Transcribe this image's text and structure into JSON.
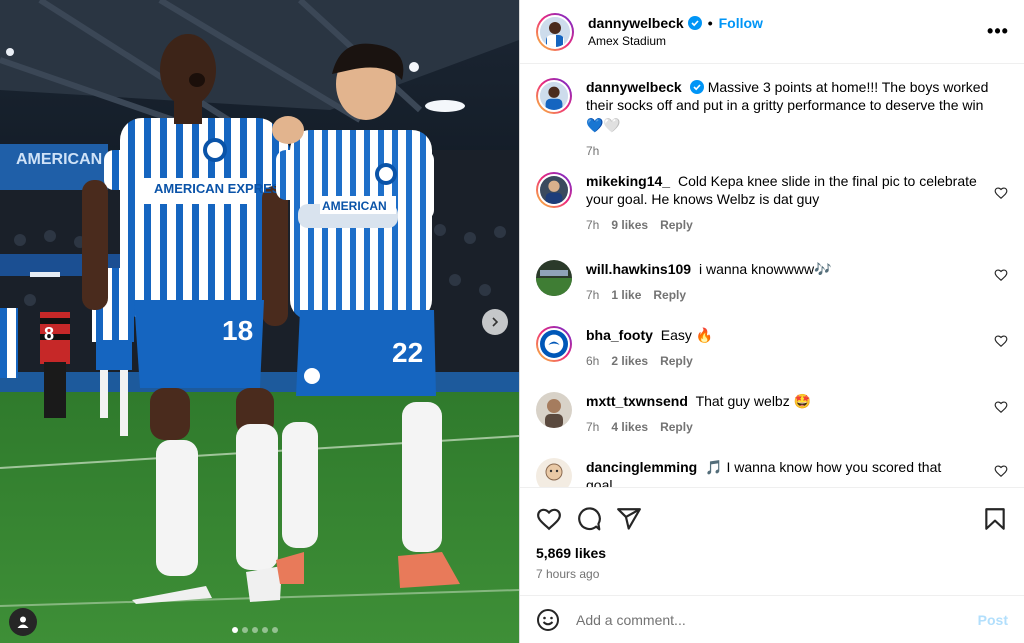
{
  "photo": {
    "ad_board_text": "AMERICAN EXPRESS",
    "shirt_sponsor": "AMERICAN EXPRESS",
    "player1_number": "18",
    "player2_number": "22",
    "opponent_number": "8",
    "carousel_total": 5,
    "carousel_active": 0,
    "next_icon": "chevron-right-icon",
    "tag_icon": "person-tag-icon"
  },
  "post_header": {
    "username": "dannywelbeck",
    "separator": "•",
    "follow_label": "Follow",
    "location": "Amex Stadium",
    "more_label": "•••"
  },
  "caption": {
    "username": "dannywelbeck",
    "text": "Massive 3 points at home!!! The boys worked their socks off and put in a gritty performance to deserve the win",
    "emojis": "💙🤍",
    "time": "7h"
  },
  "comments": [
    {
      "username": "mikeking14_",
      "text": "Cold Kepa knee slide in the final pic to celebrate your goal. He knows Welbz is dat guy",
      "time": "7h",
      "likes": "9 likes",
      "reply": "Reply"
    },
    {
      "username": "will.hawkins109",
      "text": "i wanna knowwww🎶",
      "time": "7h",
      "likes": "1 like",
      "reply": "Reply"
    },
    {
      "username": "bha_footy",
      "text": "Easy 🔥",
      "time": "6h",
      "likes": "2 likes",
      "reply": "Reply"
    },
    {
      "username": "mxtt_txwnsend",
      "text": "That guy welbz 🤩",
      "time": "7h",
      "likes": "4 likes",
      "reply": "Reply"
    },
    {
      "username": "dancinglemming",
      "text": "🎵 I wanna know how you scored that goal...",
      "time": "",
      "likes": "",
      "reply": ""
    }
  ],
  "actions": {
    "like_icon": "heart-icon",
    "comment_icon": "comment-icon",
    "share_icon": "share-icon",
    "save_icon": "bookmark-icon"
  },
  "likes_count": "5,869 likes",
  "posted_time": "7 hours ago",
  "add_comment": {
    "placeholder": "Add a comment...",
    "post_label": "Post",
    "emoji_icon": "smiley-icon"
  },
  "colors": {
    "accent": "#0095f6",
    "brighton_blue": "#0057b8",
    "muted": "#737373",
    "post_disabled": "#b2dffc"
  }
}
